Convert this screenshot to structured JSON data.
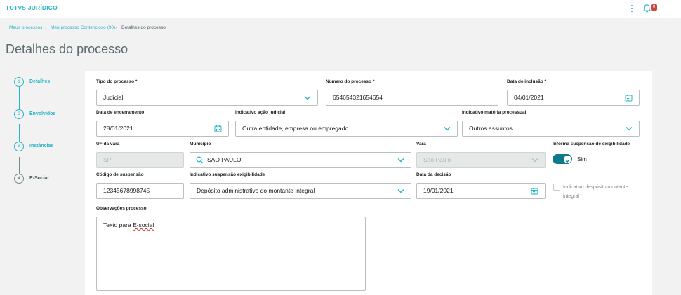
{
  "header": {
    "brand": "TOTVS JURÍDICO",
    "notifications_count": "0"
  },
  "breadcrumb": {
    "items": [
      "Meus processos",
      "Meu processo Contencioso (90)",
      "Detalhes do processo"
    ]
  },
  "page": {
    "title": "Detalhes do processo"
  },
  "steps": [
    {
      "number": "1",
      "label": "Detalhes",
      "state": "active"
    },
    {
      "number": "2",
      "label": "Envolvidos",
      "state": "done"
    },
    {
      "number": "3",
      "label": "Instâncias",
      "state": "done"
    },
    {
      "number": "4",
      "label": "E-Social",
      "state": "todo"
    }
  ],
  "form": {
    "tipo_processo": {
      "label": "Tipo do processo *",
      "value": "Judicial"
    },
    "numero_processo": {
      "label": "Número do processo *",
      "value": "654654321654654"
    },
    "data_inclusao": {
      "label": "Data de inclusão *",
      "value": "04/01/2021"
    },
    "data_encerramento": {
      "label": "Data de encerramento",
      "value": "28/01/2021"
    },
    "indicativo_acao": {
      "label": "Indicativo ação judicial",
      "value": "Outra entidade, empresa ou empregado"
    },
    "indicativo_materia": {
      "label": "Indicativo matéria processual",
      "value": "Outros assuntos"
    },
    "uf_vara": {
      "label": "UF da vara",
      "value": "SP"
    },
    "municipio": {
      "label": "Município",
      "value": "SAO PAULO"
    },
    "vara": {
      "label": "Vara",
      "value": "São Paulo"
    },
    "informa_suspensao": {
      "label": "Informa suspensão de exigibilidade",
      "value": "Sim",
      "on": true
    },
    "codigo_suspensao": {
      "label": "Código de suspensão",
      "value": "12345678998745"
    },
    "indicativo_suspensao": {
      "label": "Indicativo suspensão exigibilidade",
      "value": "Depósito administrativo do montante integral"
    },
    "data_decisao": {
      "label": "Data da decisão",
      "value": "19/01/2021"
    },
    "indicativo_deposito": {
      "label_line1": "Indicativo despósito montante",
      "label_line2": "integral",
      "checked": false
    },
    "observacoes": {
      "label": "Observações processo",
      "value_prefix": "Texto para ",
      "value_misspelled": "E-social"
    }
  },
  "colors": {
    "accent": "#29b6c5",
    "switch_on": "#0c7a8a",
    "badge": "#c64840"
  }
}
